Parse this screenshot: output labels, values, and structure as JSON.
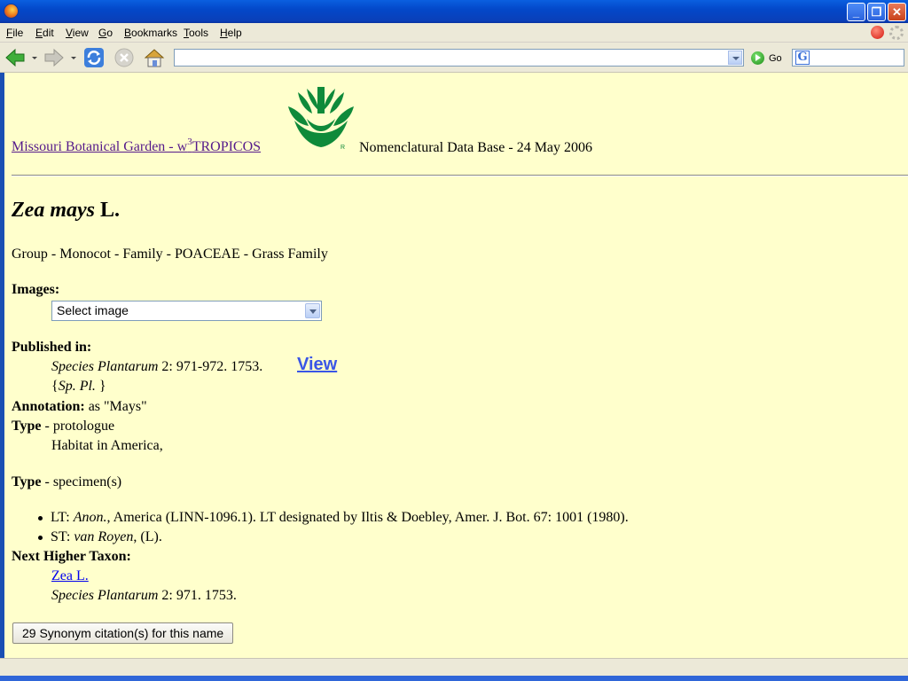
{
  "window": {
    "title": ""
  },
  "menu": {
    "items": [
      {
        "label": "File"
      },
      {
        "label": "Edit"
      },
      {
        "label": "View"
      },
      {
        "label": "Go"
      },
      {
        "label": "Bookmarks"
      },
      {
        "label": "Tools"
      },
      {
        "label": "Help"
      }
    ]
  },
  "toolbar": {
    "url": "",
    "go_label": "Go",
    "search_value": "",
    "icons": [
      "back-icon",
      "forward-icon",
      "reload-icon",
      "stop-icon",
      "home-icon",
      "go-icon"
    ]
  },
  "page": {
    "site_link_prefix": "Missouri Botanical Garden - w",
    "site_link_sup": "3",
    "site_link_suffix": "TROPICOS",
    "logo_mark": "R",
    "db_title": "Nomenclatural Data Base - 24 May 2006",
    "taxon_genus_species": "Zea mays",
    "taxon_author": "L.",
    "group_line": "Group - Monocot - Family - POACEAE - Grass Family",
    "images_label": "Images:",
    "image_select_value": "Select image",
    "published_label": "Published in:",
    "pub_title": "Species Plantarum",
    "pub_citation": " 2: 971-972. 1753.",
    "view_link": "View",
    "pub_abbrev_open": "{",
    "pub_abbrev": "Sp. Pl.",
    "pub_abbrev_close": " }",
    "annotation_label": "Annotation:",
    "annotation_value": " as \"Mays\"",
    "type_label": "Type",
    "type_value_1": " - protologue",
    "habitat": "Habitat in America,",
    "type_value_2": " - specimen(s)",
    "specimens": [
      {
        "prefix": "LT: ",
        "collector": "Anon.",
        "rest": ", America (LINN-1096.1). LT designated by Iltis & Doebley, Amer. J. Bot. 67: 1001 (1980)."
      },
      {
        "prefix": "ST: ",
        "collector": "van Royen",
        "rest": ", (L)."
      }
    ],
    "higher_label": "Next Higher Taxon:",
    "higher_link": "Zea L.",
    "higher_pub_title": "Species Plantarum",
    "higher_pub_citation": " 2: 971. 1753.",
    "synonym_button": "29 Synonym citation(s) for this name"
  },
  "status": {
    "text": ""
  },
  "colors": {
    "page_background": "#ffffcc",
    "visited_link": "#551a8b",
    "view_link": "#3a56e6",
    "logo_green": "#0f8a3a"
  }
}
